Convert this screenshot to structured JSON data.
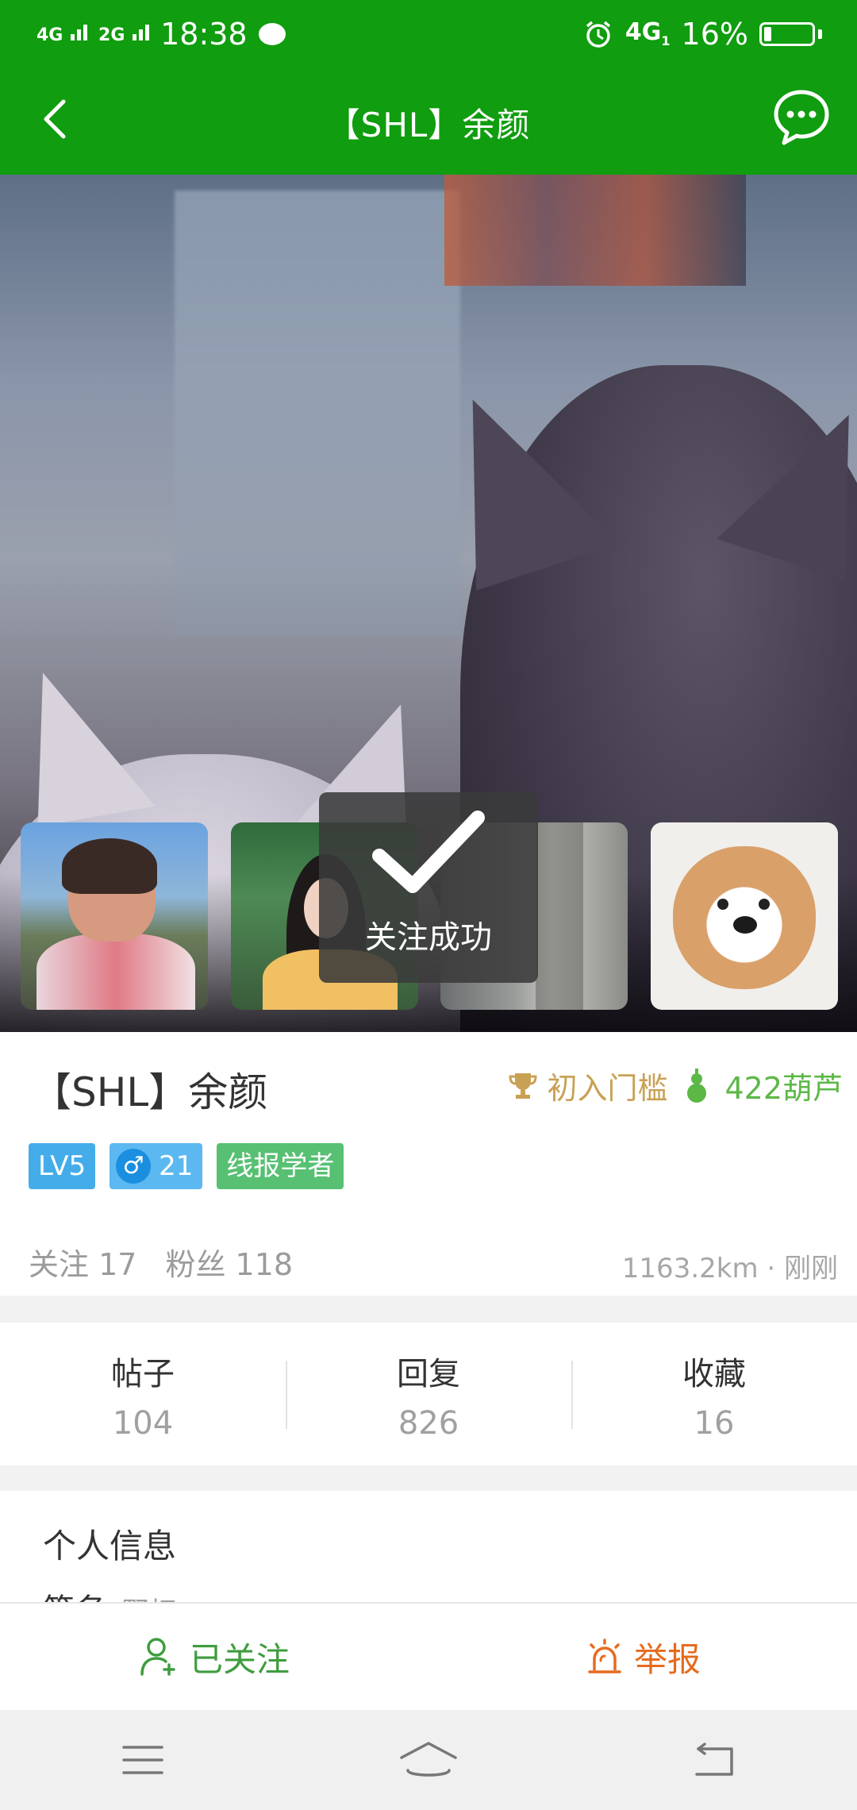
{
  "status_bar": {
    "net_left_1": "4G",
    "net_left_2": "2G",
    "time": "18:38",
    "net_right": "4G",
    "net_right_sub": "1",
    "battery_pct": "16%",
    "battery_level": 0.16
  },
  "header": {
    "title": "【SHL】余颜"
  },
  "toast": {
    "message": "关注成功"
  },
  "profile": {
    "name": "【SHL】余颜",
    "achievement": "初入门槛",
    "gourds": "422葫芦",
    "level": "LV5",
    "gender_symbol": "♂",
    "age": "21",
    "title_badge": "线报学者",
    "following": "关注 17",
    "followers": "粉丝 118",
    "distance": "1163.2km · 刚刚"
  },
  "counts": [
    {
      "label": "帖子",
      "value": "104"
    },
    {
      "label": "回复",
      "value": "826"
    },
    {
      "label": "收藏",
      "value": "16"
    }
  ],
  "info": {
    "heading": "个人信息",
    "signature_label": "签名:",
    "signature_value": "野灯"
  },
  "actions": {
    "follow_label": "已关注",
    "report_label": "举报"
  },
  "colors": {
    "brand_green": "#109d0f",
    "follow_green": "#3e9d3e",
    "report_orange": "#e66b1f",
    "level_blue": "#45acea",
    "title_green": "#57c072"
  }
}
